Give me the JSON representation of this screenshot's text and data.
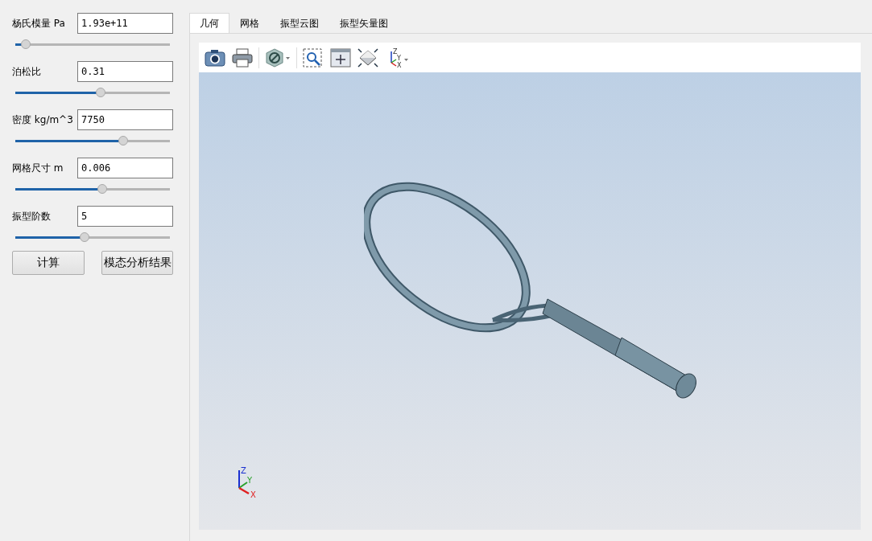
{
  "parameters": [
    {
      "label": "杨氏模量 Pa",
      "value": "1.93e+11",
      "level": 0.07
    },
    {
      "label": "泊松比",
      "value": "0.31",
      "level": 0.55
    },
    {
      "label": "密度 kg/m^3",
      "value": "7750",
      "level": 0.7
    },
    {
      "label": "网格尺寸 m",
      "value": "0.006",
      "level": 0.56
    },
    {
      "label": "振型阶数",
      "value": "5",
      "level": 0.45
    }
  ],
  "buttons": [
    {
      "label": "计算"
    },
    {
      "label": "模态分析结果"
    }
  ],
  "tabs": [
    {
      "label": "几何",
      "selected": true
    },
    {
      "label": "网格",
      "selected": false
    },
    {
      "label": "振型云图",
      "selected": false
    },
    {
      "label": "振型矢量图",
      "selected": false
    }
  ],
  "toolbar_axes": {
    "z": "Z",
    "y": "Y",
    "x": "X"
  },
  "view_triad": {
    "z": "Z",
    "y": "Y",
    "x": "X"
  }
}
